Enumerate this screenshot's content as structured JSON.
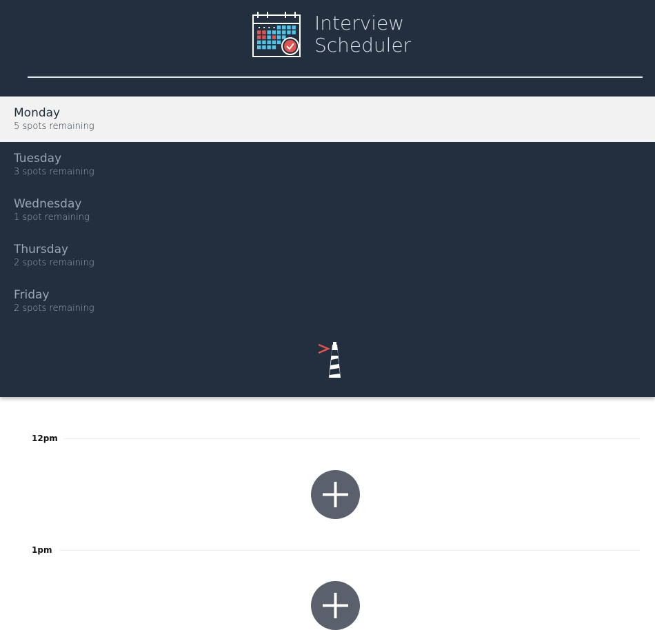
{
  "app": {
    "title_line1": "Interview",
    "title_line2": "Scheduler"
  },
  "days": [
    {
      "name": "Monday",
      "spots": "5 spots remaining",
      "selected": true
    },
    {
      "name": "Tuesday",
      "spots": "3 spots remaining",
      "selected": false
    },
    {
      "name": "Wednesday",
      "spots": "1 spot remaining",
      "selected": false
    },
    {
      "name": "Thursday",
      "spots": "2 spots remaining",
      "selected": false
    },
    {
      "name": "Friday",
      "spots": "2 spots remaining",
      "selected": false
    }
  ],
  "schedule": {
    "slots": [
      {
        "time": "12pm"
      },
      {
        "time": "1pm"
      }
    ]
  },
  "colors": {
    "sidebar_bg": "#222f3e",
    "selected_day_bg": "#f2f2f2",
    "add_button": "#5b616c",
    "accent_red": "#e2524f"
  },
  "icons": {
    "brand": "calendar-check-icon",
    "footer": "lighthouse-icon",
    "add": "plus-icon"
  }
}
